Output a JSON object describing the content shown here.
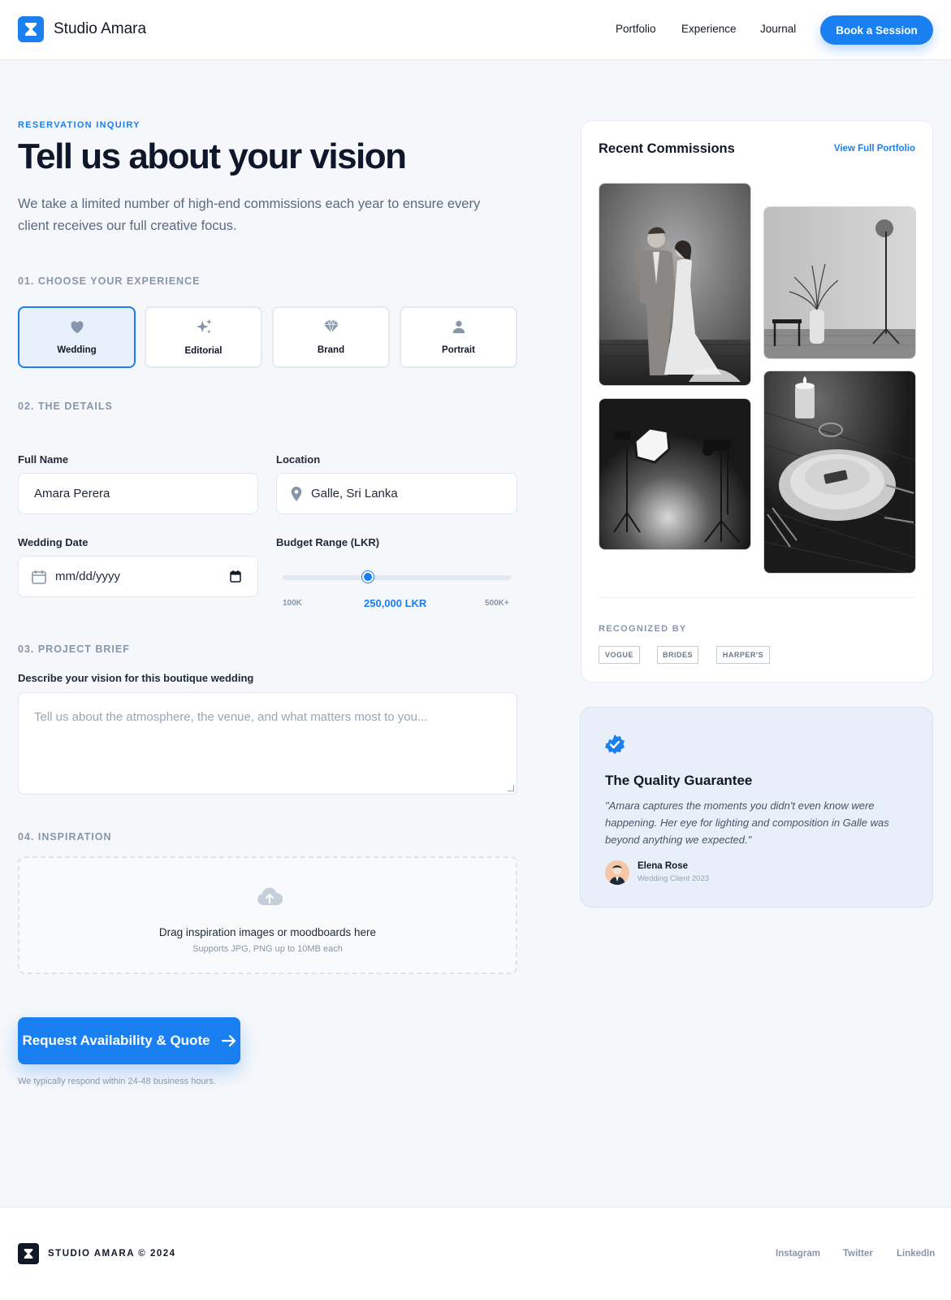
{
  "header": {
    "brand": "Studio Amara",
    "nav": [
      "Portfolio",
      "Experience",
      "Journal"
    ],
    "cta": "Book a Session"
  },
  "hero": {
    "eyebrow": "RESERVATION INQUIRY",
    "title": "Tell us about your vision",
    "subtitle": "We take a limited number of high-end commissions each year to ensure every client receives our full creative focus."
  },
  "sections": {
    "experience": "01. CHOOSE YOUR EXPERIENCE",
    "details": "02. THE DETAILS",
    "brief": "03. PROJECT BRIEF",
    "inspiration": "04. INSPIRATION"
  },
  "experiences": [
    {
      "label": "Wedding",
      "icon": "heart-icon",
      "selected": true
    },
    {
      "label": "Editorial",
      "icon": "sparkles-icon",
      "selected": false
    },
    {
      "label": "Brand",
      "icon": "diamond-icon",
      "selected": false
    },
    {
      "label": "Portrait",
      "icon": "person-icon",
      "selected": false
    }
  ],
  "form": {
    "full_name_label": "Full Name",
    "full_name_value": "Amara Perera",
    "location_label": "Location",
    "location_value": "Galle, Sri Lanka",
    "date_label": "Wedding Date",
    "date_value": "mm/dd/yyyy",
    "budget_label": "Budget Range (LKR)",
    "budget_min": "100K",
    "budget_max": "500K+",
    "budget_value": "250,000 LKR",
    "budget_fraction": 0.375,
    "brief_label": "Describe your vision for this boutique wedding",
    "brief_placeholder": "Tell us about the atmosphere, the venue, and what matters most to you..."
  },
  "dropzone": {
    "main": "Drag inspiration images or moodboards here",
    "sub": "Supports JPG, PNG up to 10MB each"
  },
  "submit": {
    "label": "Request Availability & Quote",
    "note": "We typically respond within 24-48 business hours."
  },
  "commissions": {
    "title": "Recent Commissions",
    "link": "View Full Portfolio",
    "recognized_label": "RECOGNIZED BY",
    "press": [
      "VOGUE",
      "BRIDES",
      "HARPER'S"
    ]
  },
  "guarantee": {
    "title": "The Quality Guarantee",
    "quote": "\"Amara captures the moments you didn't even know were happening. Her eye for lighting and composition in Galle was beyond anything we expected.\"",
    "name": "Elena Rose",
    "role": "Wedding Client 2023"
  },
  "footer": {
    "brand": "STUDIO AMARA © 2024",
    "links": [
      "Instagram",
      "Twitter",
      "LinkedIn"
    ]
  },
  "colors": {
    "accent": "#1a7ff0",
    "background": "#f5f7fa",
    "text": "#0f172a",
    "muted": "#8796aa"
  }
}
